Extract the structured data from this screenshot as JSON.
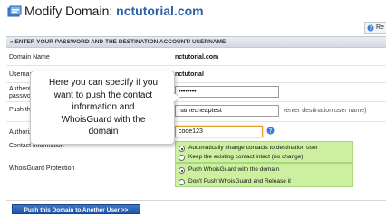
{
  "header": {
    "title_prefix": "Modify Domain:",
    "domain": "nctutorial.com",
    "help_label": "Re"
  },
  "section": {
    "title": "» ENTER YOUR PASSWORD AND THE DESTINATION ACCOUNT/ USERNAME"
  },
  "form": {
    "domain_name_label": "Domain Name",
    "domain_name_value": "nctutorial.com",
    "username_label": "Username",
    "username_value": "nctutorial",
    "auth_label_1": "Authentic",
    "auth_label_2": "password",
    "password_value": "••••••••",
    "push_label": "Push this",
    "push_value": "namecheaptest",
    "push_hint": "(enter destination user name)",
    "authorization_label": "Authoriza",
    "authorization_value": "code123",
    "contact_label": "Contact information",
    "contact_options": [
      "Automatically change contacts to destination user",
      "Keep the existing contact intact (no change)"
    ],
    "contact_selected": 0,
    "whoisguard_label": "WhoisGuard Protection",
    "whoisguard_options": [
      "Push WhoisGuard with the domain",
      "Don't Push WhoisGuard and Release it"
    ],
    "whoisguard_selected": 0,
    "submit_label": "Push this Domain to Another User >>"
  },
  "callout": {
    "text_lines": [
      "Here you can specify if  you",
      "want to push the contact",
      "information and",
      "WhoisGuard with the",
      "domain"
    ]
  },
  "colors": {
    "accent": "#2b60a8",
    "option_bg": "#ccf0a0",
    "focus_border": "#e09a2a",
    "submit_bg": "#1f56a6"
  },
  "icons": {
    "title_icon": "domain-icon",
    "help_icon": "help-icon"
  }
}
